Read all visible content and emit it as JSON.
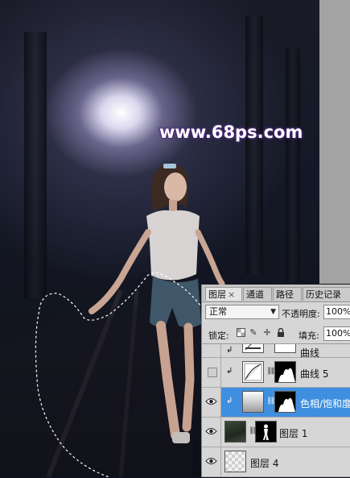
{
  "watermark": "www.68ps.com",
  "layers_panel": {
    "tabs": [
      {
        "label": "图层",
        "close": "×",
        "active": true
      },
      {
        "label": "通道",
        "active": false
      },
      {
        "label": "路径",
        "active": false
      },
      {
        "label": "历史记录",
        "active": false
      }
    ],
    "blend_mode": "正常",
    "opacity_label": "不透明度:",
    "opacity_value": "100%",
    "lock_label": "锁定:",
    "fill_label": "填充:",
    "fill_value": "100%",
    "layers": [
      {
        "name": "曲线",
        "visible": false,
        "clipped": true,
        "selected": false,
        "type": "curves"
      },
      {
        "name": "曲线 5",
        "visible": false,
        "clipped": true,
        "selected": false,
        "type": "curves"
      },
      {
        "name": "色相/饱和度",
        "visible": true,
        "clipped": true,
        "selected": true,
        "type": "hue-saturation"
      },
      {
        "name": "图层 1",
        "visible": true,
        "clipped": false,
        "selected": false,
        "type": "pixel-mask"
      },
      {
        "name": "图层 4",
        "visible": true,
        "clipped": false,
        "selected": false,
        "type": "pixel"
      }
    ]
  },
  "colors": {
    "selection_highlight": "#3f8fe0",
    "panel_bg": "#d6d6d6",
    "watermark_glow": "#4b2c7a"
  }
}
